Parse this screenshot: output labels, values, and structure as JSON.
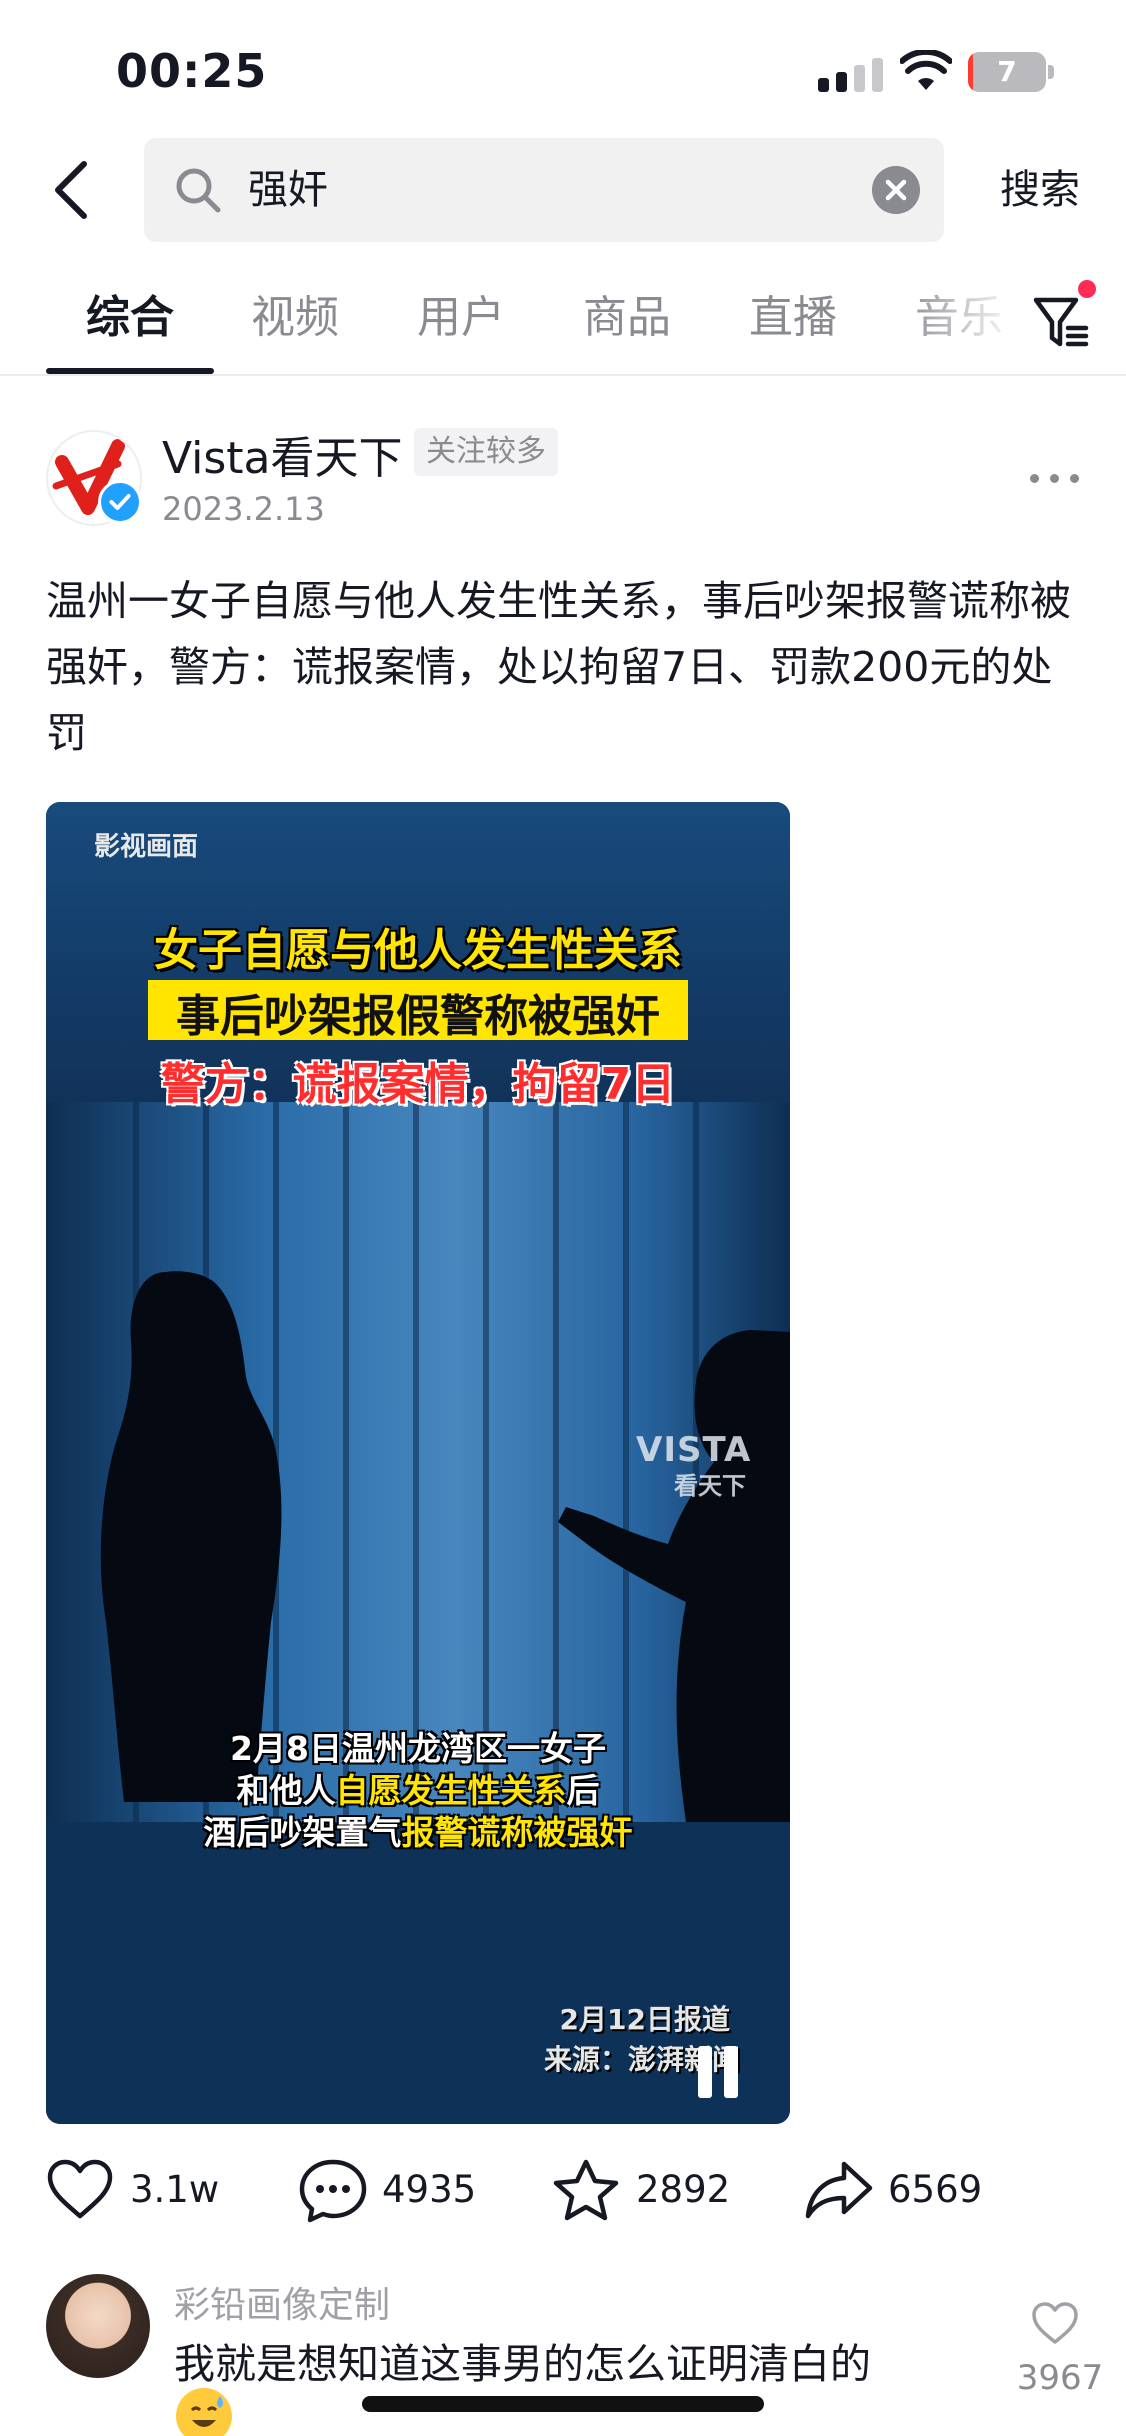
{
  "status_bar": {
    "time": "00:25",
    "battery_level": "7",
    "battery_fraction": 0.07
  },
  "search": {
    "query": "强奸",
    "submit_label": "搜索"
  },
  "tabs": [
    {
      "label": "综合",
      "active": true
    },
    {
      "label": "视频",
      "active": false
    },
    {
      "label": "用户",
      "active": false
    },
    {
      "label": "商品",
      "active": false
    },
    {
      "label": "直播",
      "active": false
    },
    {
      "label": "音乐",
      "active": false
    }
  ],
  "post": {
    "author": "Vista看天下",
    "badge": "关注较多",
    "date": "2023.2.13",
    "text": "温州一女子自愿与他人发生性关系，事后吵架报警谎称被强奸，警方：谎报案情，处以拘留7日、罚款200元的处罚"
  },
  "video": {
    "tag": "影视画面",
    "headline_1": "女子自愿与他人发生性关系",
    "headline_2": "事后吵架报假警称被强奸",
    "headline_3": "警方：谎报案情，拘留7日",
    "subtitle_1": "2月8日温州龙湾区一女子",
    "subtitle_2_a": "和他人",
    "subtitle_2_b": "自愿发生性关系",
    "subtitle_2_c": "后",
    "subtitle_3_a": "酒后吵架置气",
    "subtitle_3_b": "报警谎称被强奸",
    "report_date": "2月12日报道",
    "source": "来源：澎湃新闻",
    "watermark_top": "VISTA",
    "watermark_bottom": "看天下"
  },
  "actions": {
    "likes": "3.1w",
    "comments": "4935",
    "favorites": "2892",
    "shares": "6569"
  },
  "comment": {
    "user": "彩铅画像定制",
    "text": "我就是想知道这事男的怎么证明清白的",
    "likes": "3967"
  },
  "colors": {
    "accent": "#fe2c55",
    "verified": "#20a0ff",
    "caption_yellow": "#ffe500",
    "caption_red": "#ff2d2d"
  }
}
